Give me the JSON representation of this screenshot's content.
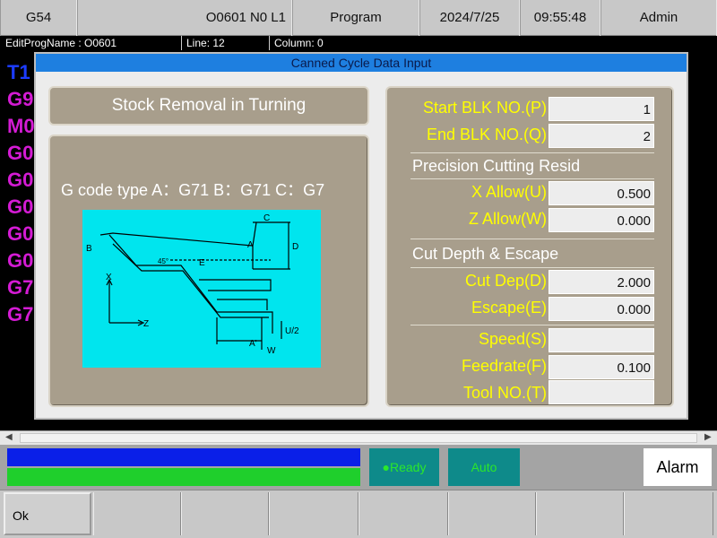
{
  "topbar": {
    "coord": "G54",
    "program_info": "O0601 N0 L1",
    "mode": "Program",
    "date": "2024/7/25",
    "time": "09:55:48",
    "user": "Admin"
  },
  "editbar": {
    "prog_name": "EditProgName : O0601",
    "line": "Line: 12",
    "column": "Column: 0"
  },
  "program_lines": [
    {
      "text": "T1",
      "color": "#1c3cff"
    },
    {
      "text": "G9",
      "color": "#d41bd4"
    },
    {
      "text": "M0",
      "color": "#d41bd4"
    },
    {
      "text": "G0",
      "color": "#d41bd4"
    },
    {
      "text": "G0",
      "color": "#d41bd4"
    },
    {
      "text": "G0",
      "color": "#d41bd4"
    },
    {
      "text": "G0",
      "color": "#d41bd4"
    },
    {
      "text": "G0",
      "color": "#d41bd4"
    },
    {
      "text": "G7",
      "color": "#d41bd4"
    },
    {
      "text": "G7",
      "color": "#d41bd4"
    }
  ],
  "dialog": {
    "title": "Canned Cycle Data Input",
    "cycle_name": "Stock Removal in Turning",
    "gcode_type": "G code type   A：G71   B：G71   C：G7",
    "diagram_labels": {
      "a": "A",
      "a_prime": "A'",
      "b": "B",
      "c": "C",
      "d": "D",
      "w": "W",
      "u2": "U/2",
      "x": "X",
      "z": "Z",
      "angle": "45°",
      "e": "E"
    },
    "fields": {
      "start_blk": {
        "label": "Start BLK NO.(P)",
        "value": "1"
      },
      "end_blk": {
        "label": "End BLK NO.(Q)",
        "value": "2"
      },
      "precision_header": "Precision Cutting Resid",
      "x_allow": {
        "label": "X Allow(U)",
        "value": "0.500"
      },
      "z_allow": {
        "label": "Z Allow(W)",
        "value": "0.000"
      },
      "cut_header": "Cut Depth & Escape",
      "cut_dep": {
        "label": "Cut Dep(D)",
        "value": "2.000"
      },
      "escape": {
        "label": "Escape(E)",
        "value": "0.000"
      },
      "speed": {
        "label": "Speed(S)",
        "value": ""
      },
      "feedrate": {
        "label": "Feedrate(F)",
        "value": "0.100"
      },
      "tool_no": {
        "label": "Tool NO.(T)",
        "value": ""
      }
    }
  },
  "status": {
    "ready": "●Ready",
    "auto": "Auto",
    "alarm": "Alarm"
  },
  "softkeys": {
    "ok": "Ok"
  },
  "colors": {
    "title_bar": "#1e7fe0",
    "label_yellow": "#ffff00",
    "diagram_bg": "#00e5ee",
    "panel": "#a89e8c"
  }
}
